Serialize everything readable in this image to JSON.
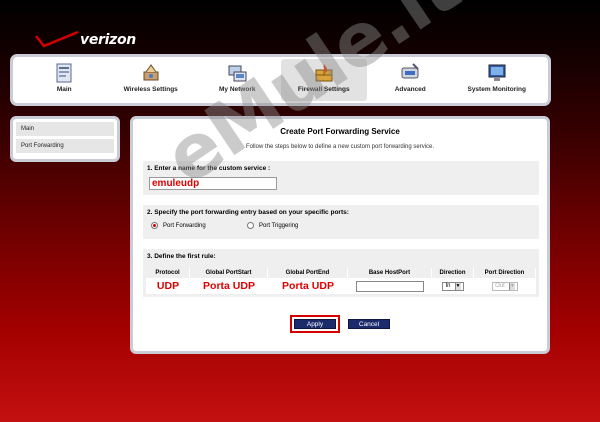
{
  "brand": {
    "logo_text": "verizon"
  },
  "nav": {
    "items": [
      {
        "label": "Main",
        "icon": "main-icon"
      },
      {
        "label": "Wireless Settings",
        "icon": "wireless-icon"
      },
      {
        "label": "My Network",
        "icon": "network-icon"
      },
      {
        "label": "Firewall Settings",
        "icon": "firewall-icon",
        "active": true
      },
      {
        "label": "Advanced",
        "icon": "advanced-icon"
      },
      {
        "label": "System Monitoring",
        "icon": "monitor-icon"
      }
    ]
  },
  "sidebar": {
    "items": [
      {
        "label": "Main"
      },
      {
        "label": "Port Forwarding"
      }
    ]
  },
  "main": {
    "title": "Create Port Forwarding Service",
    "subtitle": "Follow the steps below to define a new custom port forwarding service.",
    "step1": {
      "heading": "1. Enter a name for the custom service :",
      "value": "emuleudp"
    },
    "step2": {
      "heading": "2. Specify the port forwarding entry based on your specific ports:",
      "options": [
        {
          "label": "Port Forwarding",
          "selected": true
        },
        {
          "label": "Port Triggering",
          "selected": false
        }
      ]
    },
    "step3": {
      "heading": "3. Define the first rule:",
      "columns": [
        "Protocol",
        "Global PortStart",
        "Global PortEnd",
        "Base HostPort",
        "Direction",
        "Port Direction"
      ],
      "row": {
        "protocol": "UDP",
        "port_start": "Porta UDP",
        "port_end": "Porta UDP",
        "base_host_port": "",
        "direction": "In",
        "port_direction": "Out"
      }
    },
    "buttons": {
      "apply": "Apply",
      "cancel": "Cancel"
    }
  },
  "watermark": "eMule.it",
  "colors": {
    "accent": "#d40000",
    "button": "#1b2b6b",
    "frame": "#c9ccd6"
  }
}
